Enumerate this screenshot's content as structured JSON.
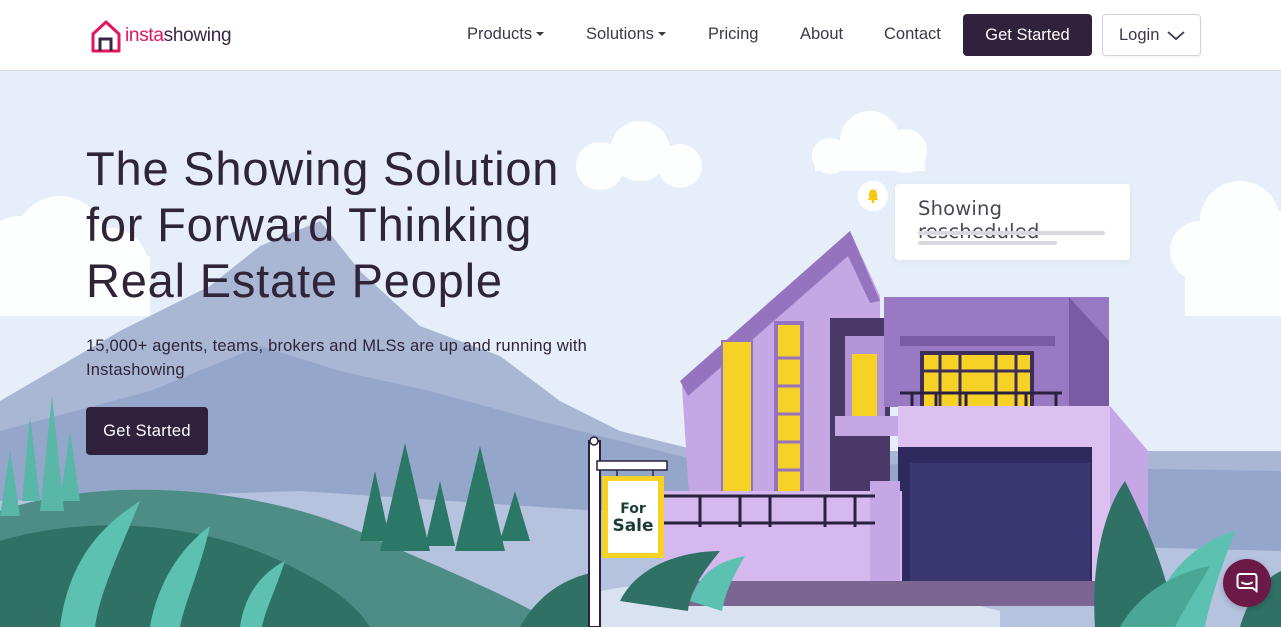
{
  "brand": {
    "name_part1": "insta",
    "name_part2": "showing",
    "accent_color": "#e3155f",
    "dark_color": "#30213c"
  },
  "nav": {
    "items": [
      {
        "label": "Products",
        "has_dropdown": true
      },
      {
        "label": "Solutions",
        "has_dropdown": true
      },
      {
        "label": "Pricing",
        "has_dropdown": false
      },
      {
        "label": "About",
        "has_dropdown": false
      },
      {
        "label": "Contact",
        "has_dropdown": false
      }
    ],
    "cta_label": "Get Started",
    "login_label": "Login"
  },
  "hero": {
    "title_line1": "The Showing Solution",
    "title_line2": "for Forward Thinking",
    "title_line3": "Real Estate People",
    "subtitle": "15,000+ agents, teams, brokers and MLSs are up and running with Instashowing",
    "cta_label": "Get Started"
  },
  "illustration": {
    "notification_text": "Showing rescheduled",
    "sign_line1": "For",
    "sign_line2": "Sale"
  },
  "icons": {
    "logo": "house-outline-icon",
    "bell": "bell-icon",
    "chat": "chat-bubble-icon",
    "login_chevron": "chevron-down-icon"
  }
}
